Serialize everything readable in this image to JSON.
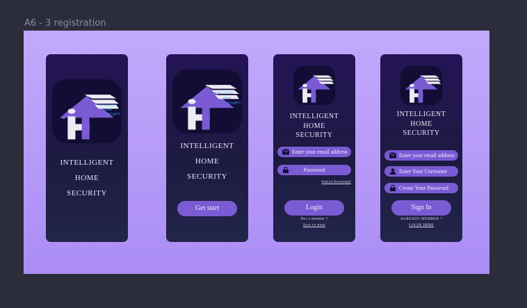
{
  "canvas": {
    "frame_label": "A6 - 3 registration"
  },
  "logo": {
    "line1": "INTELLIGENT",
    "line2": "HOME",
    "line3": "SECURITY"
  },
  "screens": [
    {
      "title_lines": [
        "INTELLIGENT",
        "HOME",
        "SECURITY"
      ]
    },
    {
      "title_lines": [
        "INTELLIGENT",
        "HOME",
        "SECURITY"
      ],
      "button": "Get start"
    },
    {
      "title_lines": [
        "INTELLIGENT",
        "HOME",
        "SECURITY"
      ],
      "fields": [
        {
          "icon": "envelope-icon",
          "placeholder": "Enter your email address"
        },
        {
          "icon": "lock-icon",
          "placeholder": "Password"
        }
      ],
      "forgot": "Forgot Password?",
      "button": "Login",
      "prompt": "Not a member ?",
      "link": "Sign up here"
    },
    {
      "title_lines": [
        "INTELLIGENT",
        "HOME",
        "SECURITY"
      ],
      "fields": [
        {
          "icon": "envelope-icon",
          "placeholder": "Enter your email address"
        },
        {
          "icon": "user-icon",
          "placeholder": "Enter Your Username"
        },
        {
          "icon": "lock-icon",
          "placeholder": "Create Your Password"
        }
      ],
      "button": "Sign In",
      "prompt": "ALREADY MEMBER ?",
      "link": "LOGIN HERE"
    }
  ],
  "colors": {
    "background": "#2c2d3b",
    "frame": "#b89cf8",
    "phone": "#1f1848",
    "accent": "#7a5bd3",
    "logo_tile": "#120d35"
  }
}
